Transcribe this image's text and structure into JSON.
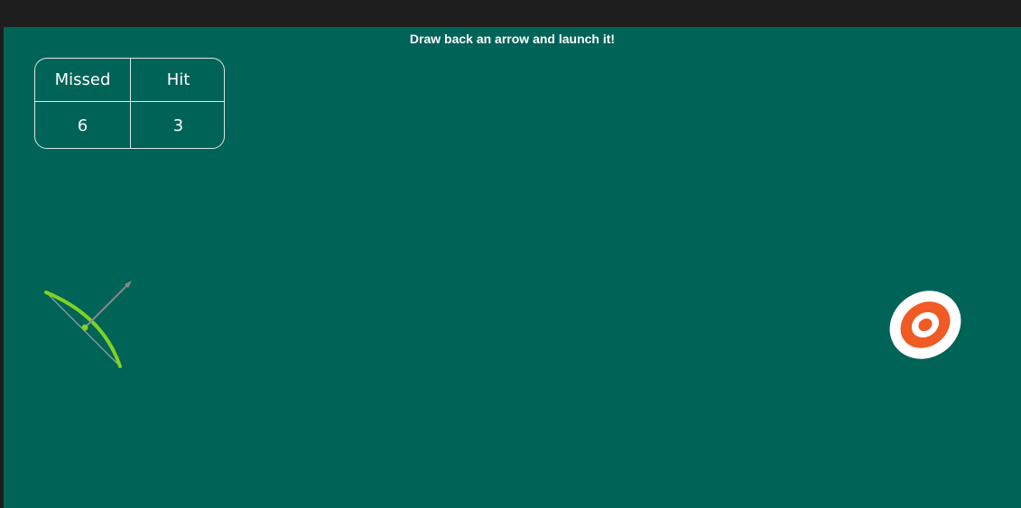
{
  "game": {
    "instructions": "Draw back an arrow and launch it!",
    "scoreboard": {
      "headers": {
        "missed": "Missed",
        "hit": "Hit"
      },
      "values": {
        "missed": "6",
        "hit": "3"
      }
    },
    "colors": {
      "background": "#006358",
      "bow": "#7ed321",
      "bowstring": "#b0b0b0",
      "arrow": "#8a8a8a",
      "target_outer": "#ffffff",
      "target_ring": "#f05a24"
    },
    "icons": [
      "bow-icon",
      "arrow-icon",
      "target-icon"
    ]
  }
}
